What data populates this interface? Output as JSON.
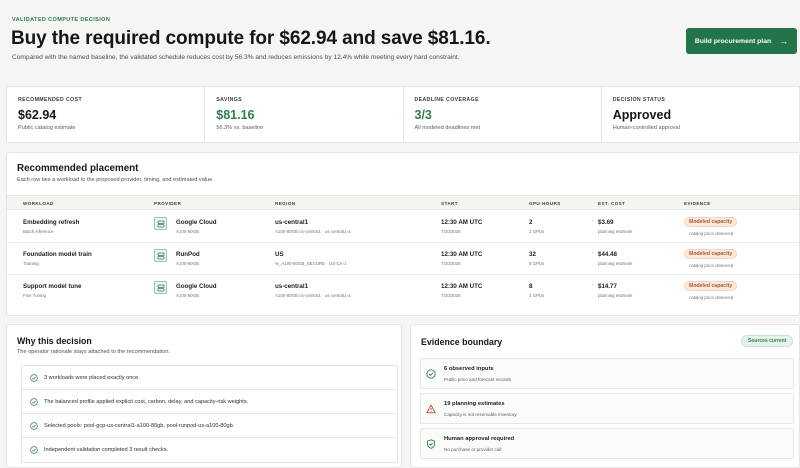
{
  "header": {
    "eyebrow": "VALIDATED COMPUTE DECISION",
    "title": "Buy the required compute for $62.94 and save $81.16.",
    "subtitle": "Compared with the named baseline, the validated schedule reduces cost by 56.3% and reduces emissions by 12.4% while meeting every hard constraint.",
    "cta_label": "Build procurement plan",
    "cta_icon": "arrow-right-icon",
    "accent_color": "#22754a"
  },
  "kpis": [
    {
      "label": "RECOMMENDED COST",
      "value": "$62.94",
      "sub": "Public catalog estimate"
    },
    {
      "label": "SAVINGS",
      "value": "$81.16",
      "sub": "56.3% vs. baseline"
    },
    {
      "label": "DEADLINE COVERAGE",
      "value": "3/3",
      "sub": "All modeled deadlines met"
    },
    {
      "label": "DECISION STATUS",
      "value": "Approved",
      "sub": "Human-controlled approval"
    }
  ],
  "placement": {
    "title": "Recommended placement",
    "description": "Each row ties a workload to the proposed provider, timing, and estimated value.",
    "columns": [
      "WORKLOAD",
      "PROVIDER",
      "REGION",
      "START",
      "GPU-HOURS",
      "EST. COST",
      "EVIDENCE"
    ],
    "rows": [
      {
        "workload": "Embedding refresh",
        "workload_sub": "Batch inference",
        "provider": "Google Cloud",
        "provider_sub": "A100-80GB",
        "region": "us-central1",
        "region_sub": "A100-80GB us-central1 · us-central1-a",
        "start": "12:30 AM UTC",
        "start_sub": "7/20/2026",
        "gpu_hours": "2",
        "gpu_sub": "2 GPUs",
        "cost": "$3.69",
        "cost_sub": "planning estimate",
        "evidence": "Modeled capacity",
        "evidence_sub": "catalog price observed"
      },
      {
        "workload": "Foundation model train",
        "workload_sub": "Training",
        "provider": "RunPod",
        "provider_sub": "A100-80GB",
        "region": "US",
        "region_sub": "%_A100-80GB_SECURE · US-CA-1",
        "start": "12:30 AM UTC",
        "start_sub": "7/20/2026",
        "gpu_hours": "32",
        "gpu_sub": "8 GPUs",
        "cost": "$44.48",
        "cost_sub": "planning estimate",
        "evidence": "Modeled capacity",
        "evidence_sub": "catalog price observed"
      },
      {
        "workload": "Support model tune",
        "workload_sub": "Fine Tuning",
        "provider": "Google Cloud",
        "provider_sub": "A100-80GB",
        "region": "us-central1",
        "region_sub": "A100-80GB us-central1 · us-central1-a",
        "start": "12:30 AM UTC",
        "start_sub": "7/20/2026",
        "gpu_hours": "8",
        "gpu_sub": "4 GPUs",
        "cost": "$14.77",
        "cost_sub": "planning estimate",
        "evidence": "Modeled capacity",
        "evidence_sub": "catalog price observed"
      }
    ]
  },
  "why": {
    "title": "Why this decision",
    "description": "The operator rationale stays attached to the recommendation.",
    "items": [
      "3 workloads were placed exactly once.",
      "The balanced profile applied explicit cost, carbon, delay, and capacity-risk weights.",
      "Selected pools: pool-gcp-us-central1-a100-80gb, pool-runpod-us-a100-80gb.",
      "Independent validation completed 3 result checks."
    ]
  },
  "evidence": {
    "title": "Evidence boundary",
    "pill": "Sources current",
    "cards": [
      {
        "icon": "check-circle-icon",
        "title": "6 observed inputs",
        "sub": "Public price and forecast records"
      },
      {
        "icon": "warning-triangle-icon",
        "title": "19 planning estimates",
        "sub": "Capacity is not reservable inventory"
      },
      {
        "icon": "shield-check-icon",
        "title": "Human approval required",
        "sub": "No purchase or provider call"
      }
    ]
  }
}
